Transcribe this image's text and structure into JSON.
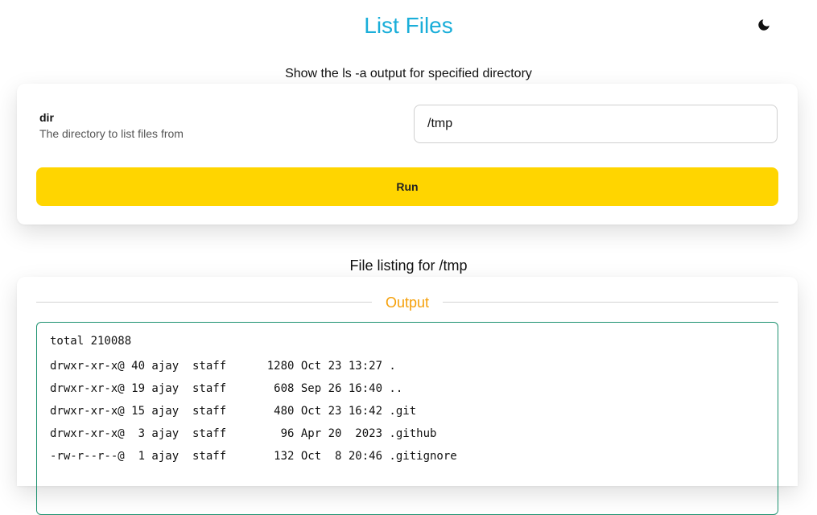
{
  "header": {
    "title": "List Files",
    "theme_toggle_icon": "moon-icon"
  },
  "tool": {
    "description": "Show the ls -a output for specified directory"
  },
  "form": {
    "field": {
      "name": "dir",
      "description": "The directory to list files from",
      "value": "/tmp"
    },
    "run_label": "Run"
  },
  "result": {
    "title": "File listing for /tmp",
    "section_label": "Output",
    "lines": [
      "total 210088",
      "drwxr-xr-x@ 40 ajay  staff      1280 Oct 23 13:27 .",
      "drwxr-xr-x@ 19 ajay  staff       608 Sep 26 16:40 ..",
      "drwxr-xr-x@ 15 ajay  staff       480 Oct 23 16:42 .git",
      "drwxr-xr-x@  3 ajay  staff        96 Apr 20  2023 .github",
      "-rw-r--r--@  1 ajay  staff       132 Oct  8 20:46 .gitignore"
    ]
  },
  "colors": {
    "title": "#1aaed9",
    "run_button": "#ffd500",
    "output_label": "#f5a00a",
    "output_border": "#1e9270"
  }
}
